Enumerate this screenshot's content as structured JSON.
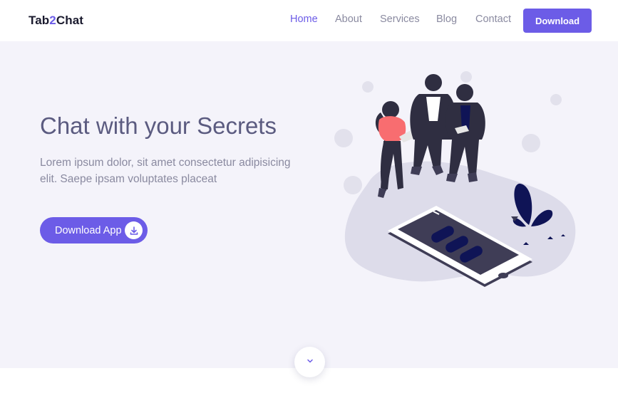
{
  "navbar": {
    "logo_prefix": "Tab",
    "logo_accent": "2",
    "logo_suffix": "Chat",
    "links": [
      "Home",
      "About",
      "Services",
      "Blog",
      "Contact"
    ],
    "active_link": "Home",
    "download_label": "Download"
  },
  "hero": {
    "title": "Chat with your Secrets",
    "text": "Lorem ipsum dolor, sit amet consectetur adipisicing elit. Saepe ipsam voluptates placeat",
    "button_label": "Download App",
    "button_icon": "download-icon",
    "illustration": "people-with-phone-illustration"
  },
  "scroll_button": {
    "icon": "chevron-down-icon"
  },
  "colors": {
    "accent": "#6c5ce7",
    "hero_bg": "#f4f3fa",
    "title": "#5b5b80",
    "muted_text": "#8a8aa0"
  }
}
